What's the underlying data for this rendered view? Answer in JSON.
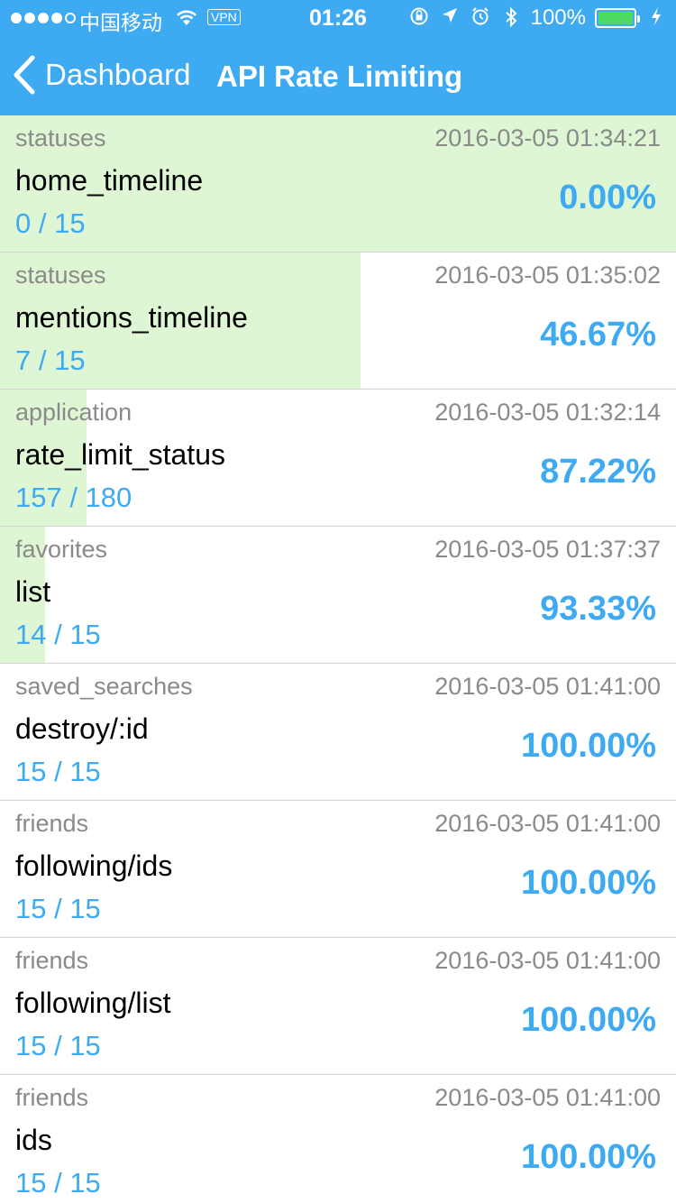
{
  "status_bar": {
    "carrier": "中国移动",
    "vpn": "VPN",
    "time": "01:26",
    "battery": "100%"
  },
  "nav": {
    "back_label": "Dashboard",
    "title": "API Rate Limiting"
  },
  "colors": {
    "accent": "#3eaaf2",
    "bar_fill": "#dff6d4",
    "muted_text": "#8a8a8a"
  },
  "rows": [
    {
      "category": "statuses",
      "timestamp": "2016-03-05 01:34:21",
      "endpoint": "home_timeline",
      "count": "0 / 15",
      "percent": "0.00%",
      "remaining_fraction": 1.0
    },
    {
      "category": "statuses",
      "timestamp": "2016-03-05 01:35:02",
      "endpoint": "mentions_timeline",
      "count": "7 / 15",
      "percent": "46.67%",
      "remaining_fraction": 0.5333
    },
    {
      "category": "application",
      "timestamp": "2016-03-05 01:32:14",
      "endpoint": "rate_limit_status",
      "count": "157 / 180",
      "percent": "87.22%",
      "remaining_fraction": 0.1278
    },
    {
      "category": "favorites",
      "timestamp": "2016-03-05 01:37:37",
      "endpoint": "list",
      "count": "14 / 15",
      "percent": "93.33%",
      "remaining_fraction": 0.0667
    },
    {
      "category": "saved_searches",
      "timestamp": "2016-03-05 01:41:00",
      "endpoint": "destroy/:id",
      "count": "15 / 15",
      "percent": "100.00%",
      "remaining_fraction": 0.0
    },
    {
      "category": "friends",
      "timestamp": "2016-03-05 01:41:00",
      "endpoint": "following/ids",
      "count": "15 / 15",
      "percent": "100.00%",
      "remaining_fraction": 0.0
    },
    {
      "category": "friends",
      "timestamp": "2016-03-05 01:41:00",
      "endpoint": "following/list",
      "count": "15 / 15",
      "percent": "100.00%",
      "remaining_fraction": 0.0
    },
    {
      "category": "friends",
      "timestamp": "2016-03-05 01:41:00",
      "endpoint": "ids",
      "count": "15 / 15",
      "percent": "100.00%",
      "remaining_fraction": 0.0
    }
  ]
}
